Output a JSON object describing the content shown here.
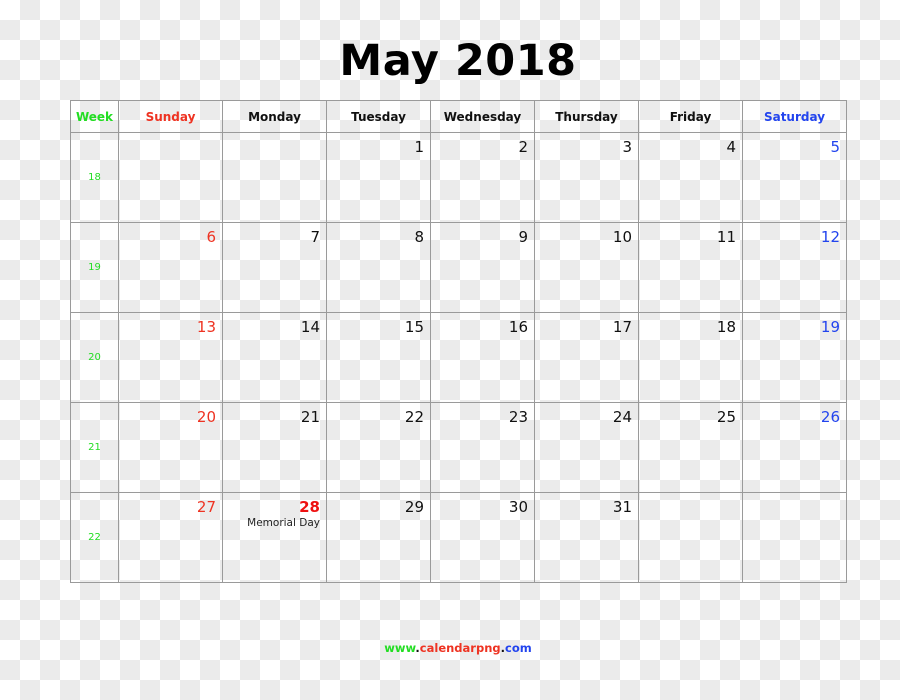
{
  "title": "May 2018",
  "colors": {
    "week": "#22dd22",
    "sunday": "#ee3322",
    "saturday": "#2244ee",
    "holiday": "#ee1111"
  },
  "headers": [
    "Week",
    "Sunday",
    "Monday",
    "Tuesday",
    "Wednesday",
    "Thursday",
    "Friday",
    "Saturday"
  ],
  "weeks": [
    {
      "week": "18",
      "days": [
        "",
        "",
        "1",
        "2",
        "3",
        "4",
        "5"
      ]
    },
    {
      "week": "19",
      "days": [
        "6",
        "7",
        "8",
        "9",
        "10",
        "11",
        "12"
      ]
    },
    {
      "week": "20",
      "days": [
        "13",
        "14",
        "15",
        "16",
        "17",
        "18",
        "19"
      ]
    },
    {
      "week": "21",
      "days": [
        "20",
        "21",
        "22",
        "23",
        "24",
        "25",
        "26"
      ]
    },
    {
      "week": "22",
      "days": [
        "27",
        "28",
        "29",
        "30",
        "31",
        "",
        ""
      ]
    }
  ],
  "events": [
    {
      "week_index": 4,
      "day_index": 1,
      "label": "Memorial Day",
      "holiday": true
    }
  ],
  "footer": {
    "www": "www",
    "dot1": ".",
    "name": "calendarpng",
    "dot2": ".",
    "tld": "com"
  }
}
